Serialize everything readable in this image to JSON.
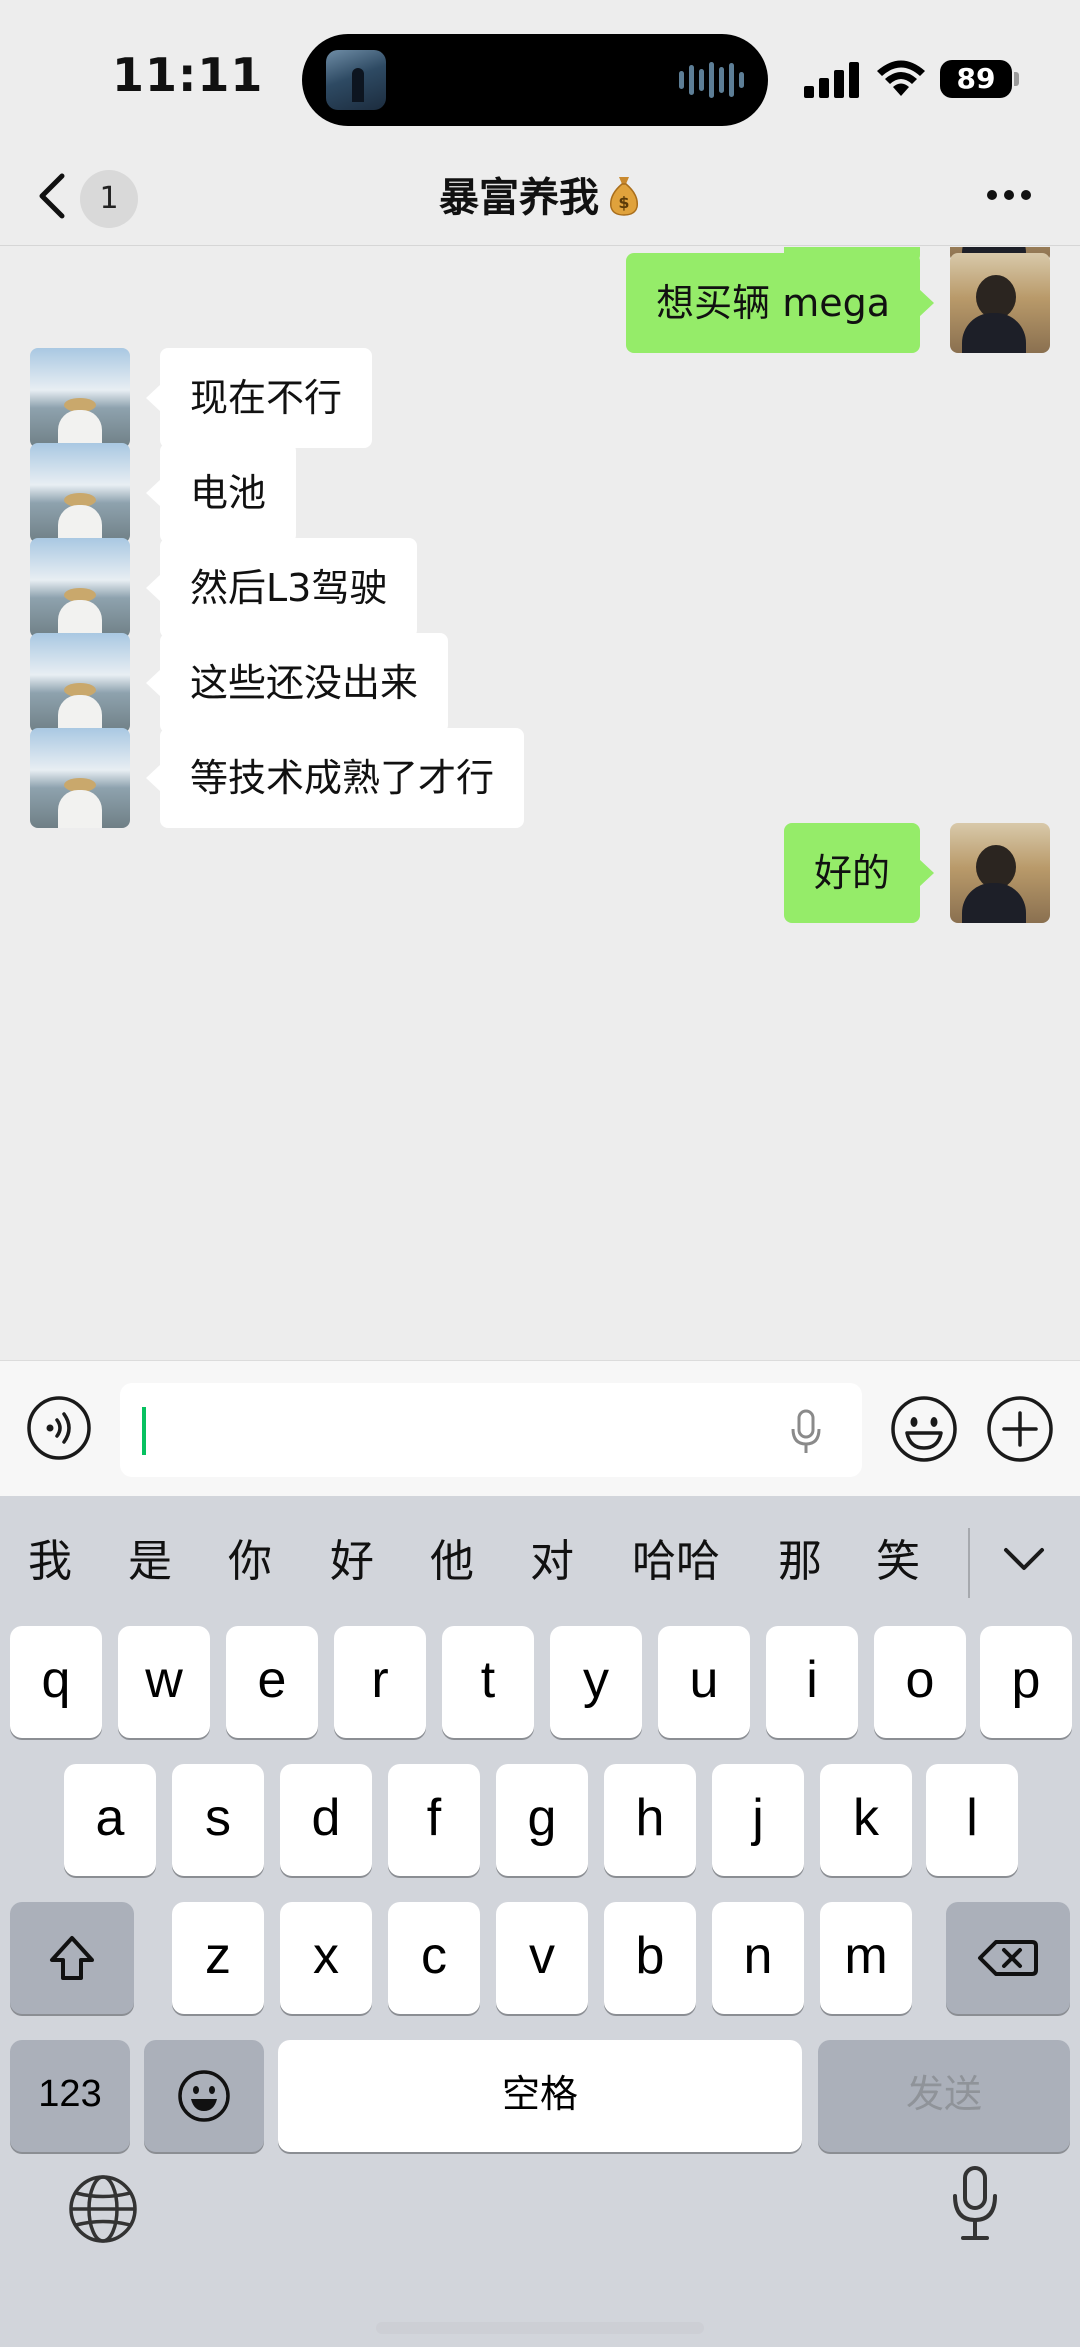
{
  "status_bar": {
    "time": "11:11",
    "battery": "89"
  },
  "header": {
    "unread_count": "1",
    "title": "暴富养我"
  },
  "messages": [
    {
      "side": "me",
      "text": "好的"
    },
    {
      "side": "me",
      "text": "想买辆 mega"
    },
    {
      "side": "other",
      "text": "现在不行"
    },
    {
      "side": "other",
      "text": "电池"
    },
    {
      "side": "other",
      "text": "然后L3驾驶"
    },
    {
      "side": "other",
      "text": "这些还没出来"
    },
    {
      "side": "other",
      "text": "等技术成熟了才行"
    },
    {
      "side": "me",
      "text": "好的"
    }
  ],
  "input": {
    "value": ""
  },
  "keyboard": {
    "candidates": [
      "我",
      "是",
      "你",
      "好",
      "他",
      "对",
      "哈哈",
      "那",
      "笑"
    ],
    "row1": [
      "q",
      "w",
      "e",
      "r",
      "t",
      "y",
      "u",
      "i",
      "o",
      "p"
    ],
    "row2": [
      "a",
      "s",
      "d",
      "f",
      "g",
      "h",
      "j",
      "k",
      "l"
    ],
    "row3": [
      "z",
      "x",
      "c",
      "v",
      "b",
      "n",
      "m"
    ],
    "numbers_key": "123",
    "space_key": "空格",
    "send_key": "发送"
  },
  "colors": {
    "my_bubble": "#95ec69",
    "other_bubble": "#ffffff",
    "chat_bg": "#ededed",
    "caret": "#07c160"
  },
  "icons": [
    "back-icon",
    "more-icon",
    "voice-icon",
    "microphone-icon",
    "emoji-icon",
    "plus-icon",
    "shift-icon",
    "delete-icon",
    "globe-icon",
    "dictation-icon",
    "collapse-icon"
  ]
}
